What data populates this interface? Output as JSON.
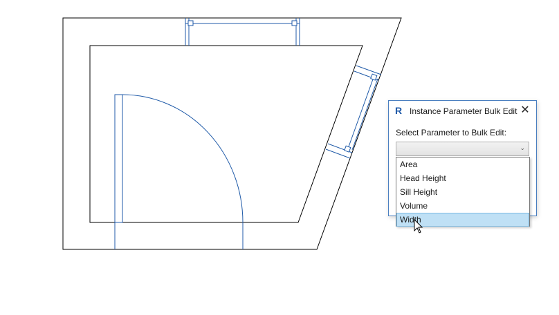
{
  "dialog": {
    "title": "Instance Parameter Bulk Edit",
    "app_icon_glyph": "R",
    "close_glyph": "✕",
    "prompt": "Select Parameter to Bulk Edit:",
    "select_value": "",
    "options": [
      {
        "label": "Area",
        "highlighted": false
      },
      {
        "label": "Head Height",
        "highlighted": false
      },
      {
        "label": "Sill Height",
        "highlighted": false
      },
      {
        "label": "Volume",
        "highlighted": false
      },
      {
        "label": "Width",
        "highlighted": true
      }
    ]
  },
  "colors": {
    "wall_line": "#000000",
    "element_line": "#1f5aa8",
    "highlight": "#bfe0f5"
  },
  "icons": {
    "app": "revit-icon",
    "close": "close-icon",
    "dropdown": "chevron-down-icon",
    "pointer": "mouse-cursor-icon"
  }
}
